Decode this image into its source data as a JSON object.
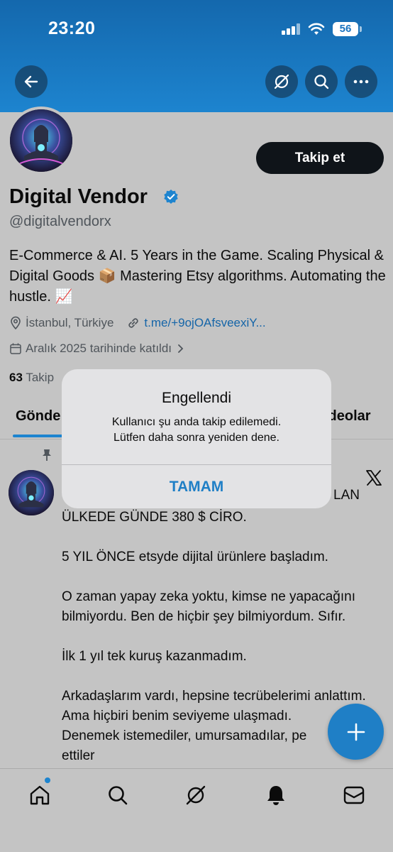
{
  "status_bar": {
    "time": "23:20",
    "battery": "56"
  },
  "header": {
    "back_icon": "arrow-left-icon",
    "grok_icon": "grok-icon",
    "search_icon": "search-icon",
    "more_icon": "more-icon"
  },
  "profile": {
    "follow_label": "Takip et",
    "name": "Digital Vendor",
    "handle": "@digitalvendorx",
    "bio": "E-Commerce & AI. 5 Years in the Game. Scaling Physical & Digital Goods 📦 Mastering Etsy algorithms. Automating the hustle. 📈",
    "location": "İstanbul, Türkiye",
    "link": "t.me/+9ojOAfsveexiY...",
    "joined": "Aralık 2025 tarihinde katıldı",
    "following_count": "63",
    "following_label": "Takip"
  },
  "tabs": {
    "first": "Gönde",
    "last": "ideolar"
  },
  "post": {
    "line_fragment": "LAN",
    "text": "ÜLKEDE GÜNDE 380 $ CİRO.\n\n5 YIL ÖNCE etsyde dijital ürünlere başladım.\n\nO zaman yapay zeka yoktu, kimse ne yapacağını bilmiyordu. Ben de hiçbir şey bilmiyordum. Sıfır.\n\nİlk 1 yıl tek kuruş kazanmadım.\n\nArkadaşlarım vardı, hepsine tecrübelerimi anlattım.\nAma hiçbiri benim seviyeme ulaşmadı.\nDenemek istemediler, umursamadılar, pe\nettiler"
  },
  "alert": {
    "title": "Engellendi",
    "message_line1": "Kullanıcı şu anda takip edilemedi.",
    "message_line2": "Lütfen daha sonra yeniden dene.",
    "button": "TAMAM"
  },
  "colors": {
    "accent": "#1d84cf",
    "banner": "#1468ad",
    "dim_background": "#c4c4c4"
  }
}
